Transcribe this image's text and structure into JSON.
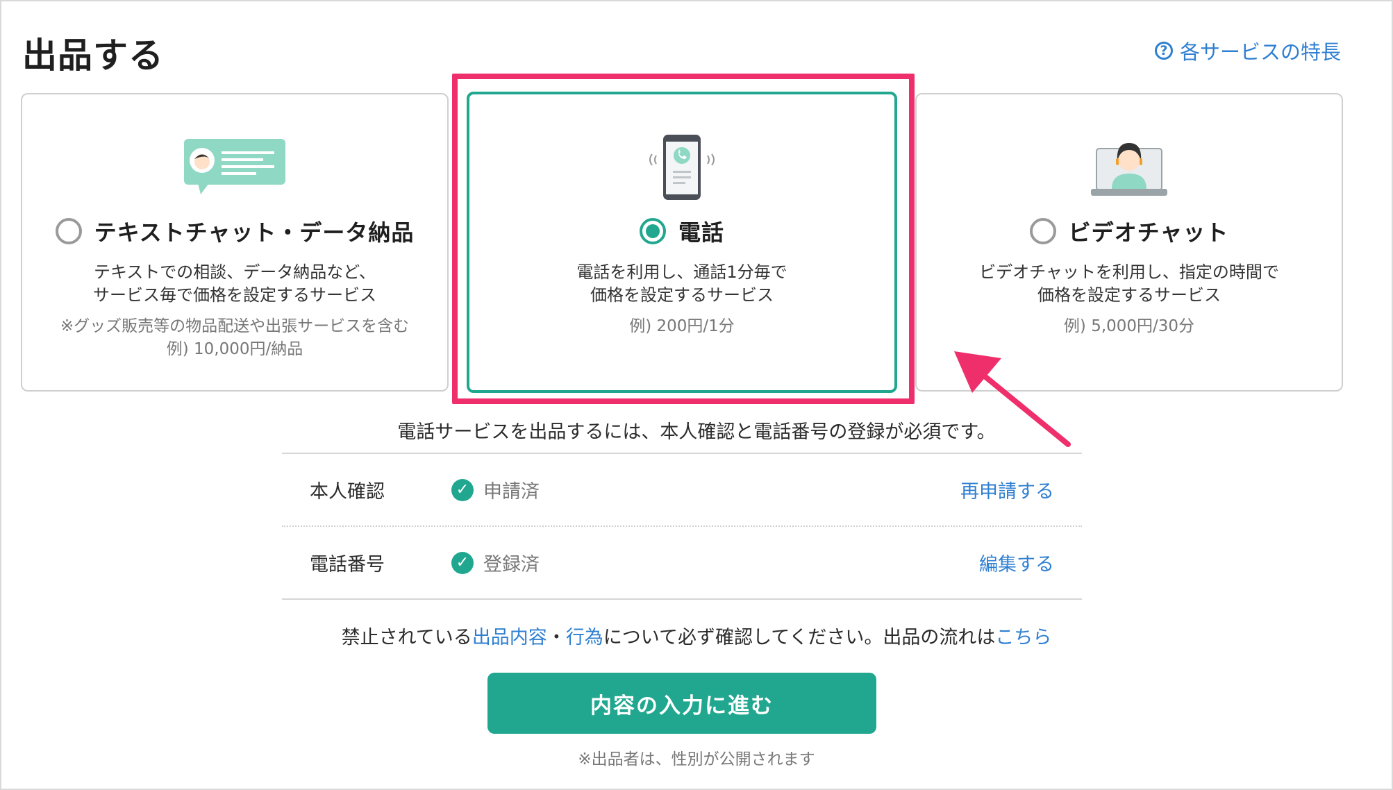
{
  "header": {
    "title": "出品する",
    "help_link": "各サービスの特長"
  },
  "services": [
    {
      "title": "テキストチャット・データ納品",
      "desc_line1": "テキストでの相談、データ納品など、",
      "desc_line2": "サービス毎で価格を設定するサービス",
      "note_line1": "※グッズ販売等の物品配送や出張サービスを含む",
      "note_line2": "例) 10,000円/納品",
      "selected": false
    },
    {
      "title": "電話",
      "desc_line1": "電話を利用し、通話1分毎で",
      "desc_line2": "価格を設定するサービス",
      "note_line1": "例) 200円/1分",
      "selected": true
    },
    {
      "title": "ビデオチャット",
      "desc_line1": "ビデオチャットを利用し、指定の時間で",
      "desc_line2": "価格を設定するサービス",
      "note_line1": "例) 5,000円/30分",
      "selected": false
    }
  ],
  "notice": "電話サービスを出品するには、本人確認と電話番号の登録が必須です。",
  "requirements": [
    {
      "label": "本人確認",
      "status": "申請済",
      "action": "再申請する"
    },
    {
      "label": "電話番号",
      "status": "登録済",
      "action": "編集する"
    }
  ],
  "rules": {
    "prefix": "禁止されている",
    "link1": "出品内容",
    "separator": "・",
    "link2": "行為",
    "middle": "について必ず確認してください。出品の流れは",
    "link3": "こちら"
  },
  "primary_button": "内容の入力に進む",
  "footnote": "※出品者は、性別が公開されます",
  "colors": {
    "accent": "#21a78f",
    "link": "#2f7fd1",
    "highlight": "#ef2f6b"
  }
}
